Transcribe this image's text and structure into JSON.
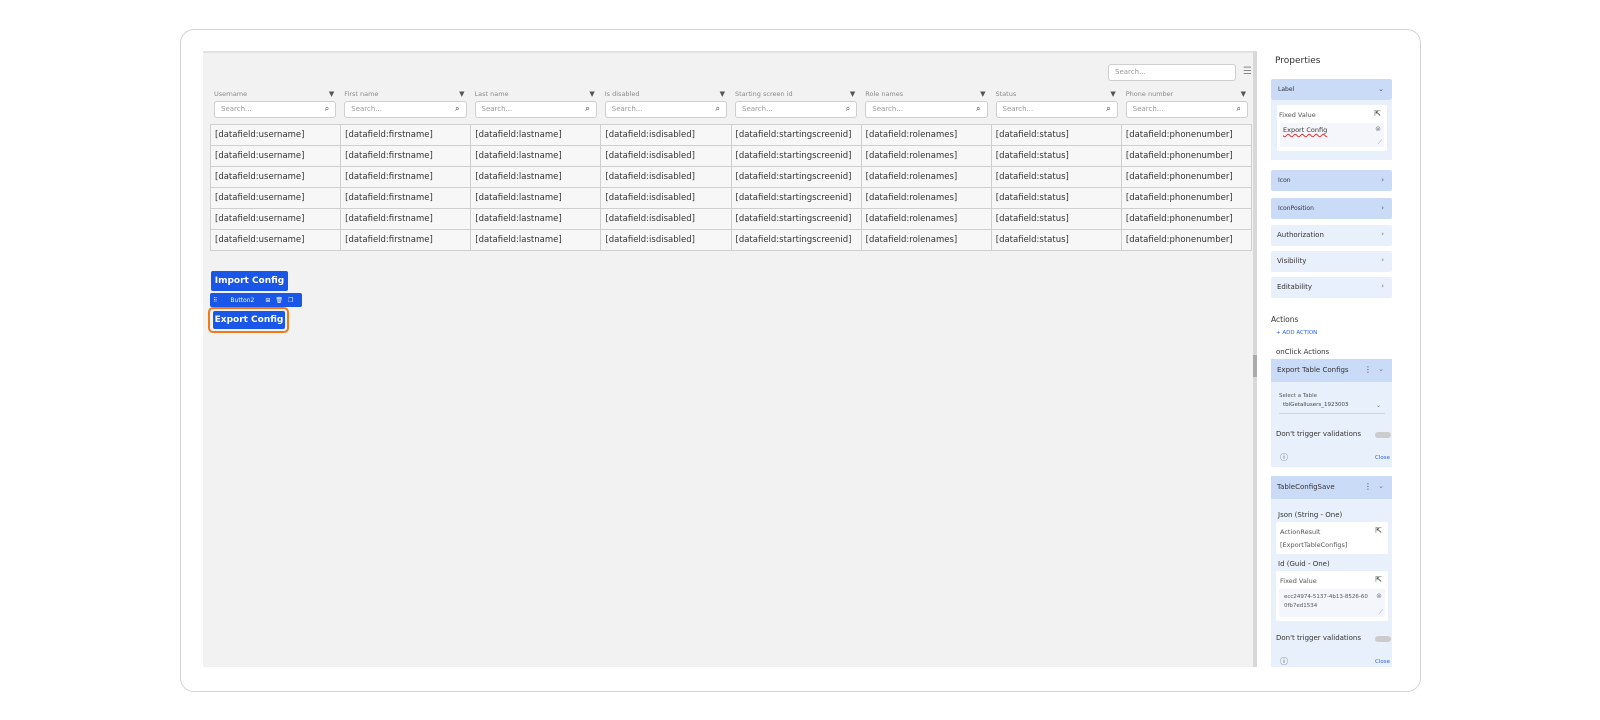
{
  "table": {
    "global_search_placeholder": "Search...",
    "columns": [
      "Username",
      "First name",
      "Last name",
      "Is disabled",
      "Starting screen id",
      "Role names",
      "Status",
      "Phone number"
    ],
    "search_placeholder": "Search...",
    "rows": [
      [
        "[datafield:username]",
        "[datafield:firstname]",
        "[datafield:lastname]",
        "[datafield:isdisabled]",
        "[datafield:startingscreenid]",
        "[datafield:rolenames]",
        "[datafield:status]",
        "[datafield:phonenumber]"
      ],
      [
        "[datafield:username]",
        "[datafield:firstname]",
        "[datafield:lastname]",
        "[datafield:isdisabled]",
        "[datafield:startingscreenid]",
        "[datafield:rolenames]",
        "[datafield:status]",
        "[datafield:phonenumber]"
      ],
      [
        "[datafield:username]",
        "[datafield:firstname]",
        "[datafield:lastname]",
        "[datafield:isdisabled]",
        "[datafield:startingscreenid]",
        "[datafield:rolenames]",
        "[datafield:status]",
        "[datafield:phonenumber]"
      ],
      [
        "[datafield:username]",
        "[datafield:firstname]",
        "[datafield:lastname]",
        "[datafield:isdisabled]",
        "[datafield:startingscreenid]",
        "[datafield:rolenames]",
        "[datafield:status]",
        "[datafield:phonenumber]"
      ],
      [
        "[datafield:username]",
        "[datafield:firstname]",
        "[datafield:lastname]",
        "[datafield:isdisabled]",
        "[datafield:startingscreenid]",
        "[datafield:rolenames]",
        "[datafield:status]",
        "[datafield:phonenumber]"
      ],
      [
        "[datafield:username]",
        "[datafield:firstname]",
        "[datafield:lastname]",
        "[datafield:isdisabled]",
        "[datafield:startingscreenid]",
        "[datafield:rolenames]",
        "[datafield:status]",
        "[datafield:phonenumber]"
      ]
    ]
  },
  "canvas": {
    "import_label": "Import Config",
    "toolbar_label": "Button2",
    "export_label": "Export Config"
  },
  "panel": {
    "title": "Properties",
    "label_section": "Label",
    "fixed_value": "Fixed Value",
    "label_value": "Export Config",
    "icon_section": "Icon",
    "icon_position_section": "IconPosition",
    "authorization": "Authorization",
    "visibility": "Visibility",
    "editability": "Editability",
    "actions": "Actions",
    "add_action": "+ ADD ACTION",
    "onclick_actions": "onClick Actions",
    "action1": {
      "title": "Export Table Configs",
      "select_table_label": "Select a Table",
      "select_table_value": "tblGetallusers_1923003",
      "dont_trigger": "Don't trigger validations",
      "close": "Close"
    },
    "action2": {
      "title": "TableConfigSave",
      "json_label": "Json (String - One)",
      "action_result": "ActionResult",
      "action_result_value": "[ExportTableConfigs]",
      "id_label": "Id (Guid - One)",
      "fixed_value": "Fixed Value",
      "guid_value": "ecc24974-5137-4b13-8526-600fb7ed1534",
      "dont_trigger": "Don't trigger validations",
      "close": "Close"
    }
  },
  "colors": {
    "accent": "#1a56e8",
    "highlight": "#f07a1a",
    "panel_section": "#c9dbf7"
  }
}
